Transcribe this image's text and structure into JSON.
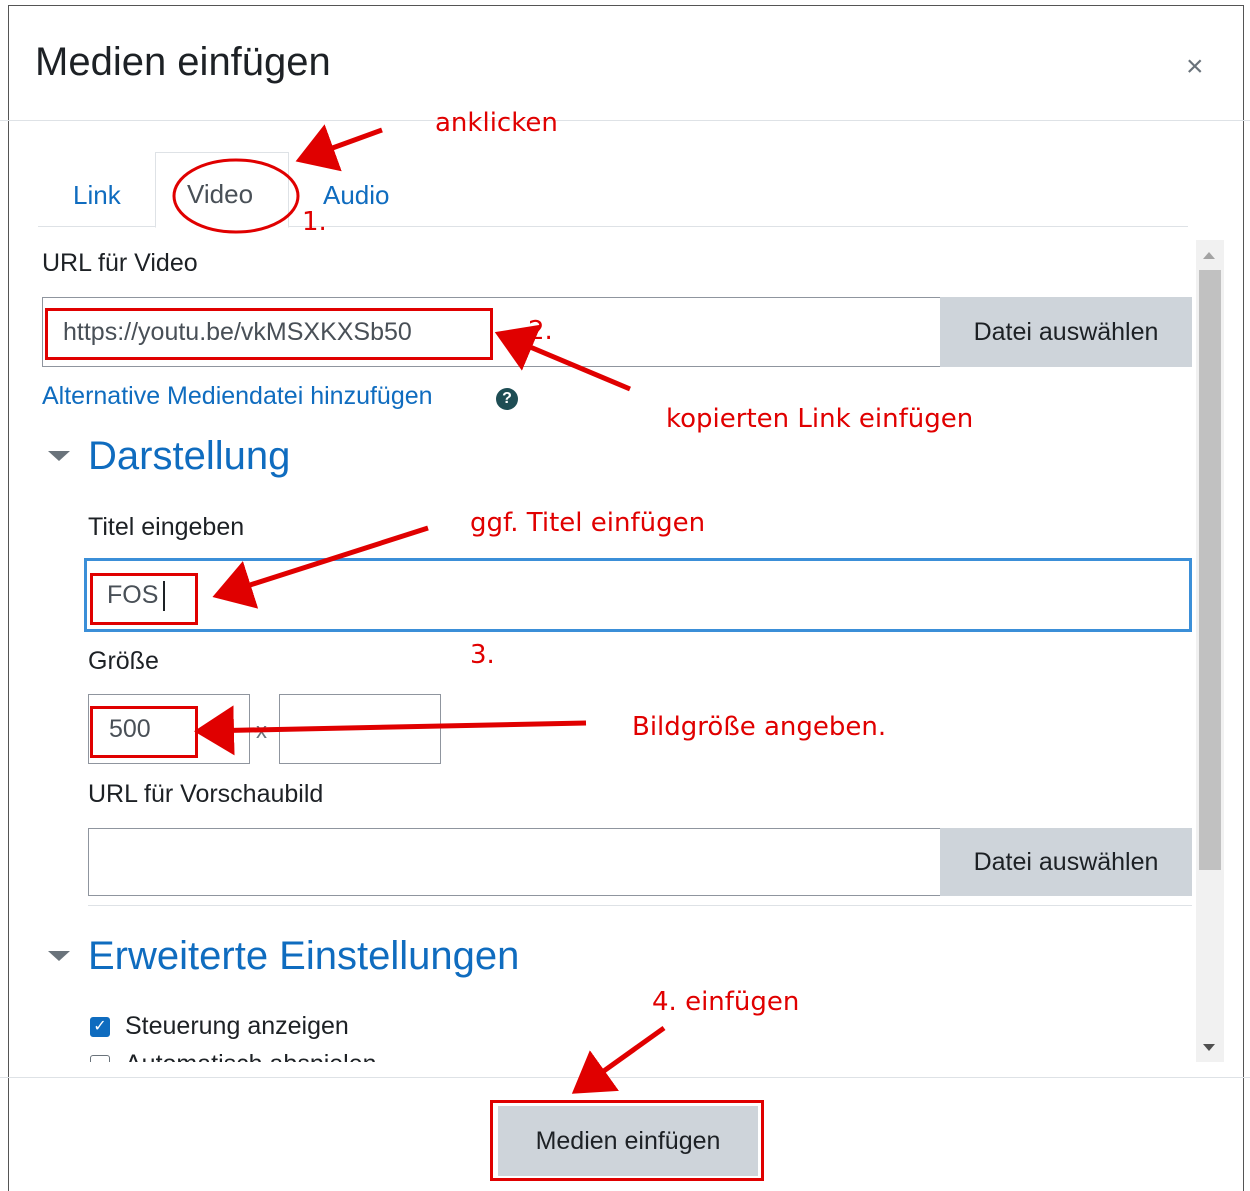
{
  "dialog": {
    "title": "Medien einfügen",
    "close_symbol": "×"
  },
  "tabs": [
    {
      "label": "Link"
    },
    {
      "label": "Video"
    },
    {
      "label": "Audio"
    }
  ],
  "video": {
    "url_label": "URL für Video",
    "url_value": "https://youtu.be/vkMSXKXSb50",
    "file_button": "Datei auswählen",
    "alt_link": "Alternative Mediendatei hinzufügen",
    "help_symbol": "?"
  },
  "darstellung": {
    "heading": "Darstellung",
    "title_label": "Titel eingeben",
    "title_value": "FOS",
    "size_label": "Größe",
    "width_value": "500",
    "height_value": "",
    "times_symbol": "x",
    "poster_label": "URL für Vorschaubild",
    "poster_value": "",
    "poster_button": "Datei auswählen"
  },
  "advanced": {
    "heading": "Erweiterte Einstellungen",
    "controls_label": "Steuerung anzeigen",
    "controls_checked": true,
    "autoplay_label": "Automatisch abspielen",
    "autoplay_checked": false
  },
  "footer": {
    "insert_button": "Medien einfügen"
  },
  "annotations": {
    "click": "anklicken",
    "step1": "1.",
    "step2": "2.",
    "paste_link": "kopierten Link einfügen",
    "title_hint": "ggf. Titel einfügen",
    "step3": "3.",
    "size_hint": "Bildgröße angeben.",
    "step4": "4.  einfügen",
    "color": "#e00000"
  },
  "colors": {
    "link_blue": "#0f6cbf",
    "button_gray": "#ced4da",
    "focus_border": "#3b8fd8"
  }
}
